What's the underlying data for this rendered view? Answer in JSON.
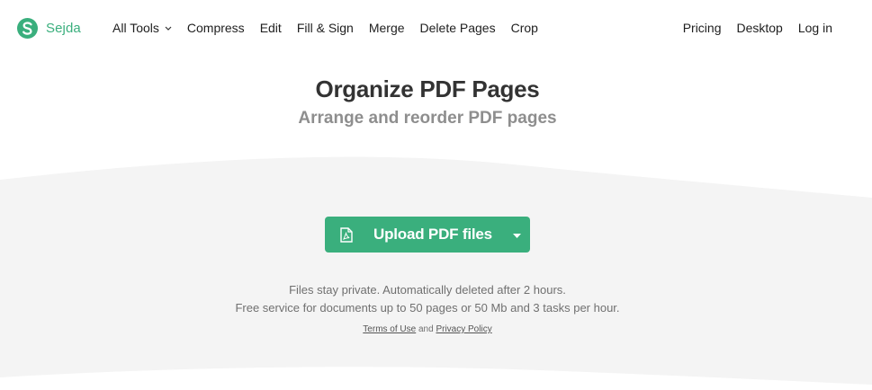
{
  "brand": {
    "name": "Sejda",
    "logo_letter": "S",
    "color": "#3aaf7d"
  },
  "nav": {
    "left_items": [
      {
        "label": "All Tools",
        "has_dropdown": true
      },
      {
        "label": "Compress"
      },
      {
        "label": "Edit"
      },
      {
        "label": "Fill & Sign"
      },
      {
        "label": "Merge"
      },
      {
        "label": "Delete Pages"
      },
      {
        "label": "Crop"
      }
    ],
    "right_items": [
      {
        "label": "Pricing"
      },
      {
        "label": "Desktop"
      },
      {
        "label": "Log in"
      }
    ]
  },
  "hero": {
    "title": "Organize PDF Pages",
    "subtitle": "Arrange and reorder PDF pages"
  },
  "upload": {
    "label": "Upload PDF files",
    "icon": "pdf-file-icon",
    "dropdown_icon": "caret-down-icon",
    "color": "#3aaf7d"
  },
  "info": {
    "line1": "Files stay private. Automatically deleted after 2 hours.",
    "line2": "Free service for documents up to 50 pages or 50 Mb and 3 tasks per hour."
  },
  "legal": {
    "terms_label": "Terms of Use",
    "conjunction": "and",
    "privacy_label": "Privacy Policy"
  },
  "colors": {
    "panel_background": "#f4f4f4",
    "title": "#333333",
    "subtitle": "#8e8e8e"
  }
}
